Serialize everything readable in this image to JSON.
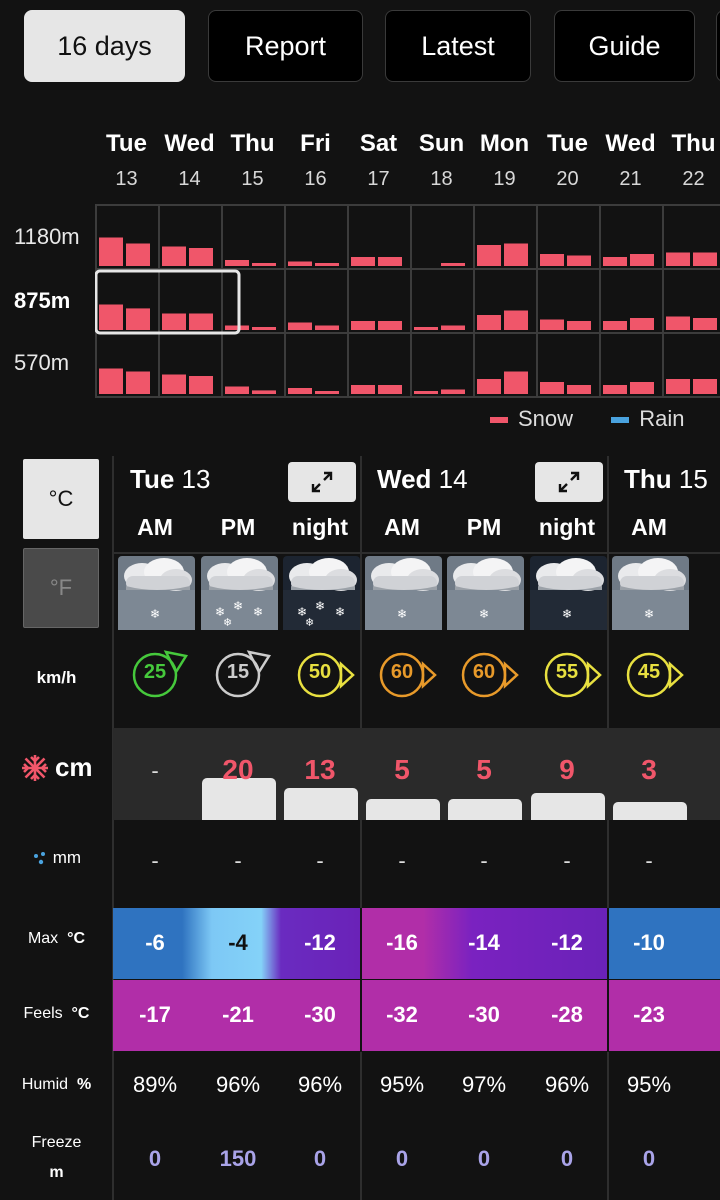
{
  "tabs": [
    {
      "label": "16 days",
      "active": true
    },
    {
      "label": "Report",
      "active": false
    },
    {
      "label": "Latest",
      "active": false
    },
    {
      "label": "Guide",
      "active": false
    }
  ],
  "overview": {
    "days": [
      {
        "name": "Tue",
        "date": "13"
      },
      {
        "name": "Wed",
        "date": "14"
      },
      {
        "name": "Thu",
        "date": "15"
      },
      {
        "name": "Fri",
        "date": "16"
      },
      {
        "name": "Sat",
        "date": "17"
      },
      {
        "name": "Sun",
        "date": "18"
      },
      {
        "name": "Mon",
        "date": "19"
      },
      {
        "name": "Tue",
        "date": "20"
      },
      {
        "name": "Wed",
        "date": "21"
      },
      {
        "name": "Thu",
        "date": "22"
      }
    ],
    "elevations": [
      "1180m",
      "875m",
      "570m"
    ],
    "selected_elevation": "875m",
    "legend": {
      "snow": "Snow",
      "rain": "Rain",
      "snow_color": "#f0566a",
      "rain_color": "#4aa3df"
    },
    "snow_levels": [
      [
        [
          0.95,
          0.75
        ],
        [
          0.65,
          0.6
        ],
        [
          0.2,
          0.08
        ],
        [
          0.15,
          0.08
        ],
        [
          0.3,
          0.3
        ],
        [
          0,
          0.1
        ],
        [
          0.7,
          0.75
        ],
        [
          0.4,
          0.35
        ],
        [
          0.3,
          0.4
        ],
        [
          0.45,
          0.45
        ]
      ],
      [
        [
          0.85,
          0.72
        ],
        [
          0.55,
          0.55
        ],
        [
          0.15,
          0.08
        ],
        [
          0.25,
          0.15
        ],
        [
          0.3,
          0.3
        ],
        [
          0.1,
          0.15
        ],
        [
          0.5,
          0.65
        ],
        [
          0.35,
          0.3
        ],
        [
          0.3,
          0.4
        ],
        [
          0.45,
          0.4
        ]
      ],
      [
        [
          0.85,
          0.75
        ],
        [
          0.65,
          0.6
        ],
        [
          0.25,
          0.12
        ],
        [
          0.2,
          0.1
        ],
        [
          0.3,
          0.3
        ],
        [
          0.05,
          0.15
        ],
        [
          0.5,
          0.75
        ],
        [
          0.4,
          0.3
        ],
        [
          0.3,
          0.4
        ],
        [
          0.5,
          0.5
        ]
      ]
    ]
  },
  "detail": {
    "units": {
      "celsius": "°C",
      "fahrenheit": "°F"
    },
    "days": [
      {
        "name": "Tue",
        "date": "13"
      },
      {
        "name": "Wed",
        "date": "14"
      },
      {
        "name": "Thu",
        "date": "15"
      }
    ],
    "periods": [
      "AM",
      "PM",
      "night",
      "AM",
      "PM",
      "night",
      "AM"
    ],
    "row_labels": {
      "wind": "km/h",
      "snow": "cm",
      "rain": "mm",
      "max": "Max",
      "feels": "Feels",
      "humid": "Humid",
      "freeze": "Freeze",
      "unit_c": "°C",
      "unit_pct": "%",
      "unit_m": "m"
    },
    "weather_icons": [
      "snow-cloud-icon",
      "heavy-snow-cloud-icon",
      "heavy-snow-night-icon",
      "snow-cloud-icon",
      "snow-cloud-icon",
      "snow-night-icon",
      "snow-cloud-icon"
    ],
    "wind": [
      {
        "speed": "25",
        "color": "#46c93c",
        "dir": "ne"
      },
      {
        "speed": "15",
        "color": "#cccccc",
        "dir": "ne"
      },
      {
        "speed": "50",
        "color": "#e8e040",
        "dir": "e"
      },
      {
        "speed": "60",
        "color": "#e89a2a",
        "dir": "e"
      },
      {
        "speed": "60",
        "color": "#e89a2a",
        "dir": "e"
      },
      {
        "speed": "55",
        "color": "#e8e040",
        "dir": "e"
      },
      {
        "speed": "45",
        "color": "#e8e040",
        "dir": "e"
      }
    ],
    "snow": [
      "-",
      "20",
      "13",
      "5",
      "5",
      "9",
      "3"
    ],
    "snow_amount": [
      0,
      20,
      13,
      5,
      5,
      9,
      3
    ],
    "rain": [
      "-",
      "-",
      "-",
      "-",
      "-",
      "-",
      "-"
    ],
    "max": [
      "-6",
      "-4",
      "-12",
      "-16",
      "-14",
      "-12",
      "-10"
    ],
    "feels": [
      "-17",
      "-21",
      "-30",
      "-32",
      "-30",
      "-28",
      "-23"
    ],
    "humid": [
      "89%",
      "96%",
      "96%",
      "95%",
      "97%",
      "96%",
      "95%"
    ],
    "freeze": [
      "0",
      "150",
      "0",
      "0",
      "0",
      "0",
      "0"
    ],
    "colors": {
      "snow_value": "#f0566a",
      "freeze_value": "#a9a3e8",
      "feels_band": "#b12ea8"
    }
  }
}
